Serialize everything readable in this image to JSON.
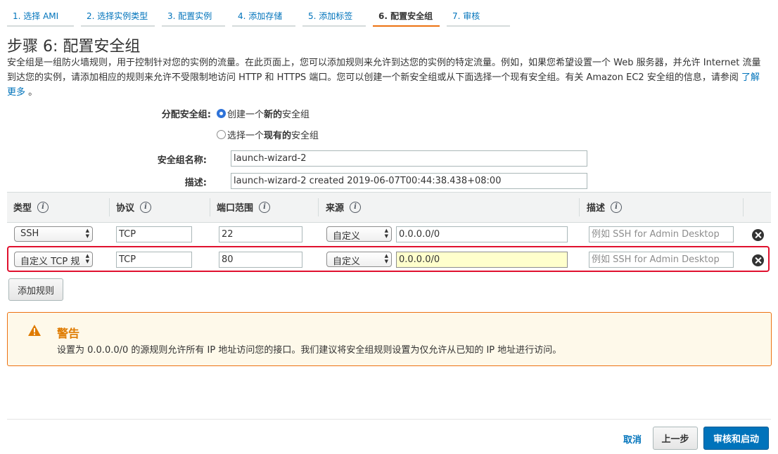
{
  "wizard": {
    "steps": [
      {
        "label": "1. 选择 AMI"
      },
      {
        "label": "2. 选择实例类型"
      },
      {
        "label": "3. 配置实例"
      },
      {
        "label": "4. 添加存储"
      },
      {
        "label": "5. 添加标签"
      },
      {
        "label": "6. 配置安全组",
        "active": true
      },
      {
        "label": "7. 审核"
      }
    ]
  },
  "page": {
    "title": "步骤 6: 配置安全组",
    "intro": "安全组是一组防火墙规则，用于控制针对您的实例的流量。在此页面上，您可以添加规则来允许到达您的实例的特定流量。例如，如果您希望设置一个 Web 服务器，并允许 Internet 流量到达您的实例，请添加相应的规则来允许不受限制地访问 HTTP 和 HTTPS 端口。您可以创建一个新安全组或从下面选择一个现有安全组。有关 Amazon EC2 安全组的信息，请参阅",
    "learn_more": "了解更多",
    "intro_end": "。"
  },
  "assign": {
    "label": "分配安全组:",
    "option_create_prefix": "创建一个",
    "option_create_bold": "新的",
    "option_create_suffix": "安全组",
    "option_existing_prefix": "选择一个",
    "option_existing_bold": "现有的",
    "option_existing_suffix": "安全组",
    "selected": "create"
  },
  "form": {
    "name_label": "安全组名称:",
    "name_value": "launch-wizard-2",
    "desc_label": "描述:",
    "desc_value": "launch-wizard-2 created 2019-06-07T00:44:38.438+08:00"
  },
  "table": {
    "headers": {
      "type": "类型",
      "protocol": "协议",
      "port_range": "端口范围",
      "source": "来源",
      "description": "描述",
      "info_glyph": "i"
    },
    "rows": [
      {
        "type": "SSH",
        "protocol": "TCP",
        "port": "22",
        "source_mode": "自定义",
        "source_cidr": "0.0.0.0/0",
        "desc_placeholder": "例如 SSH for Admin Desktop"
      },
      {
        "type": "自定义 TCP 规",
        "protocol": "TCP",
        "port": "80",
        "source_mode": "自定义",
        "source_cidr": "0.0.0.0/0",
        "desc_placeholder": "例如 SSH for Admin Desktop"
      }
    ],
    "add_rule": "添加规则"
  },
  "warning": {
    "title": "警告",
    "text": "设置为 0.0.0.0/0 的源规则允许所有 IP 地址访问您的接口。我们建议将安全组规则设置为仅允许从已知的 IP 地址进行访问。",
    "color": "#df7b00"
  },
  "footer": {
    "cancel": "取消",
    "previous": "上一步",
    "review_launch": "审核和启动"
  },
  "colors": {
    "link": "#0073bb",
    "active_tab": "#ec7211",
    "primary_button": "#0073bb",
    "highlight_border": "#e0102e",
    "cidr_highlight": "#ffffcc"
  }
}
